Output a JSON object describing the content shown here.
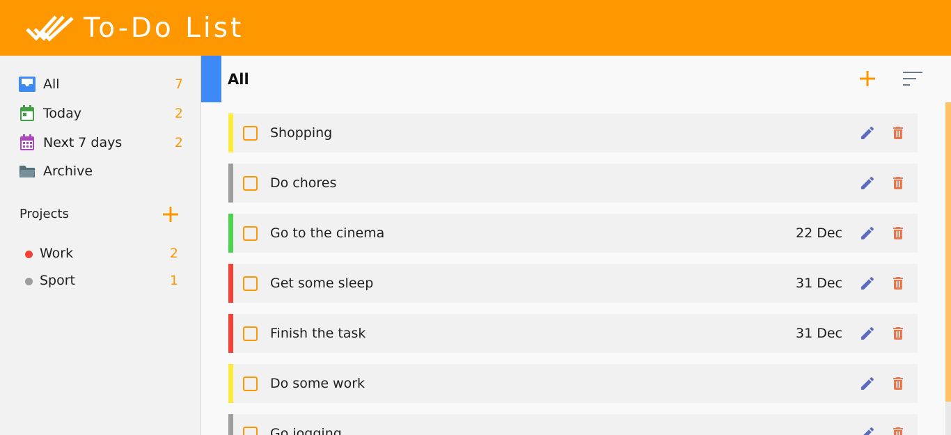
{
  "app": {
    "title": "To-Do List"
  },
  "colors": {
    "brand": "#ff9800",
    "accent_blue": "#3d8af7",
    "edit_icon": "#5c6bc0",
    "delete_icon": "#e57850"
  },
  "sidebar": {
    "items": [
      {
        "label": "All",
        "count": "7",
        "icon": "inbox-icon",
        "icon_color": "#3d8af7"
      },
      {
        "label": "Today",
        "count": "2",
        "icon": "calendar-day-icon",
        "icon_color": "#43a047"
      },
      {
        "label": "Next 7 days",
        "count": "2",
        "icon": "calendar-week-icon",
        "icon_color": "#ab47bc"
      },
      {
        "label": "Archive",
        "count": "",
        "icon": "folder-icon",
        "icon_color": "#607d8b"
      }
    ],
    "projects_label": "Projects",
    "projects": [
      {
        "label": "Work",
        "count": "2",
        "color": "#f44336"
      },
      {
        "label": "Sport",
        "count": "1",
        "color": "#9e9e9e"
      }
    ]
  },
  "main": {
    "title": "All",
    "tasks": [
      {
        "label": "Shopping",
        "due": "",
        "priority_color": "#ffeb3b"
      },
      {
        "label": "Do chores",
        "due": "",
        "priority_color": "#9e9e9e"
      },
      {
        "label": "Go to the cinema",
        "due": "22 Dec",
        "priority_color": "#4cd44c"
      },
      {
        "label": "Get some sleep",
        "due": "31 Dec",
        "priority_color": "#f44336"
      },
      {
        "label": "Finish the task",
        "due": "31 Dec",
        "priority_color": "#f44336"
      },
      {
        "label": "Do some work",
        "due": "",
        "priority_color": "#ffeb3b"
      },
      {
        "label": "Go jogging",
        "due": "",
        "priority_color": "#9e9e9e"
      }
    ]
  }
}
